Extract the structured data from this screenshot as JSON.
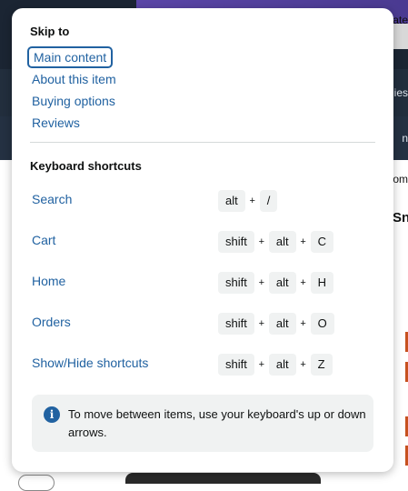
{
  "background": {
    "right_texts": [
      "rate",
      "ies",
      "n",
      "om",
      "Sn"
    ]
  },
  "skip_to": {
    "heading": "Skip to",
    "links": [
      {
        "label": "Main content"
      },
      {
        "label": "About this item"
      },
      {
        "label": "Buying options"
      },
      {
        "label": "Reviews"
      }
    ]
  },
  "shortcuts": {
    "heading": "Keyboard shortcuts",
    "items": [
      {
        "label": "Search",
        "keys": [
          "alt",
          "/"
        ]
      },
      {
        "label": "Cart",
        "keys": [
          "shift",
          "alt",
          "C"
        ]
      },
      {
        "label": "Home",
        "keys": [
          "shift",
          "alt",
          "H"
        ]
      },
      {
        "label": "Orders",
        "keys": [
          "shift",
          "alt",
          "O"
        ]
      },
      {
        "label": "Show/Hide shortcuts",
        "keys": [
          "shift",
          "alt",
          "Z"
        ]
      }
    ],
    "plus_symbol": "+"
  },
  "info": {
    "icon": "info-icon",
    "icon_glyph": "i",
    "text": "To move between items, use your keyboard's up or down arrows."
  },
  "colors": {
    "link": "#2162a1",
    "text": "#0f1111",
    "key_bg": "#f0f2f2"
  }
}
